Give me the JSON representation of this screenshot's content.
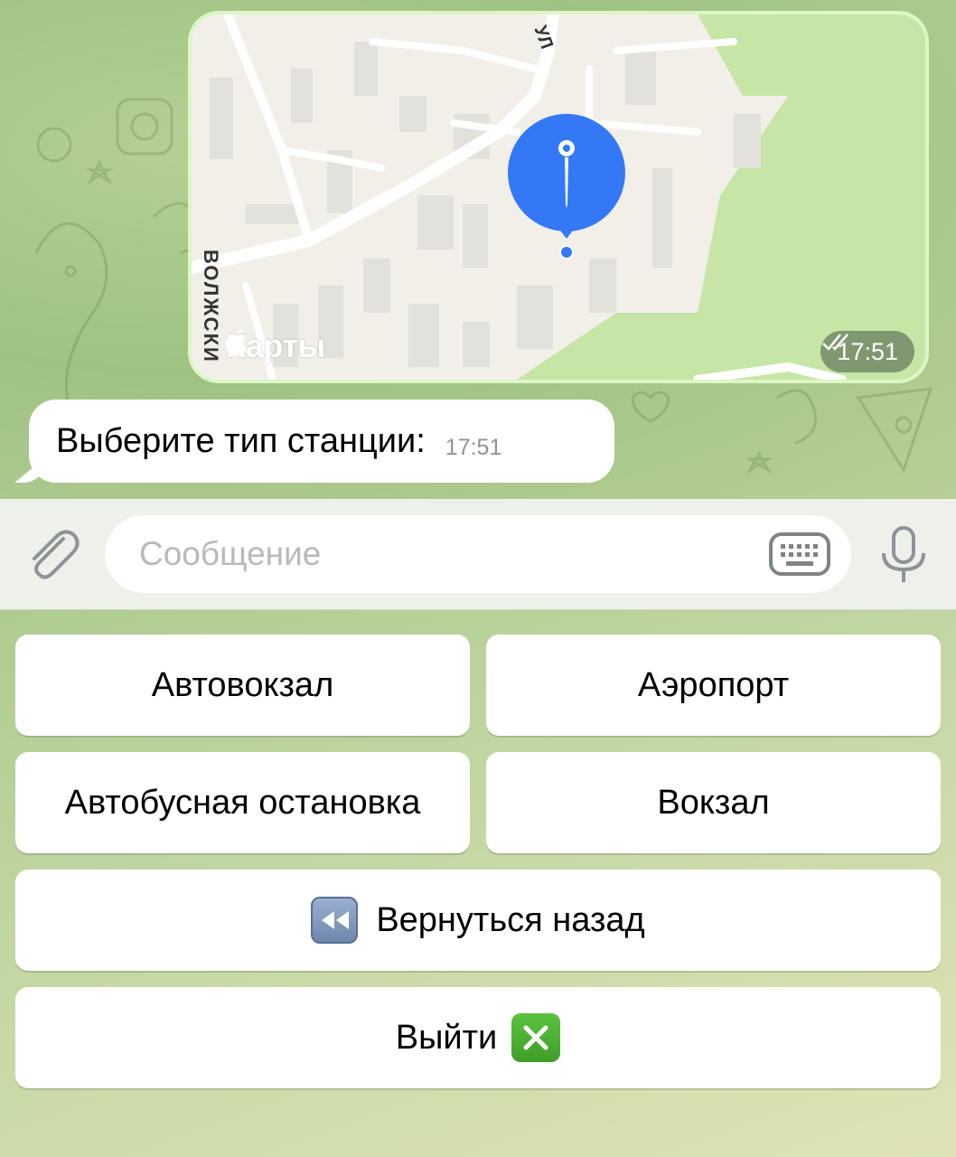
{
  "map_message": {
    "provider_label": "Карты",
    "street_vertical": "ВОЛЖСКИ",
    "street_top": "УЛ",
    "time": "17:51",
    "status": "read"
  },
  "text_message": {
    "text": "Выберите тип станции:",
    "time": "17:51"
  },
  "composer": {
    "placeholder": "Сообщение",
    "value": ""
  },
  "reply_keyboard": {
    "row1": [
      "Автовокзал",
      "Аэропорт"
    ],
    "row2": [
      "Автобусная остановка",
      "Вокзал"
    ],
    "back_label": "Вернуться назад",
    "exit_label": "Выйти"
  },
  "icons": {
    "attach": "paperclip-icon",
    "keyboard": "keyboard-icon",
    "mic": "microphone-icon",
    "back_emoji": "rewind-icon",
    "exit_emoji": "cross-mark-icon"
  },
  "colors": {
    "pin": "#3478f6",
    "outgoing_bubble": "#dcf7c5",
    "park": "#c7e5a6"
  }
}
